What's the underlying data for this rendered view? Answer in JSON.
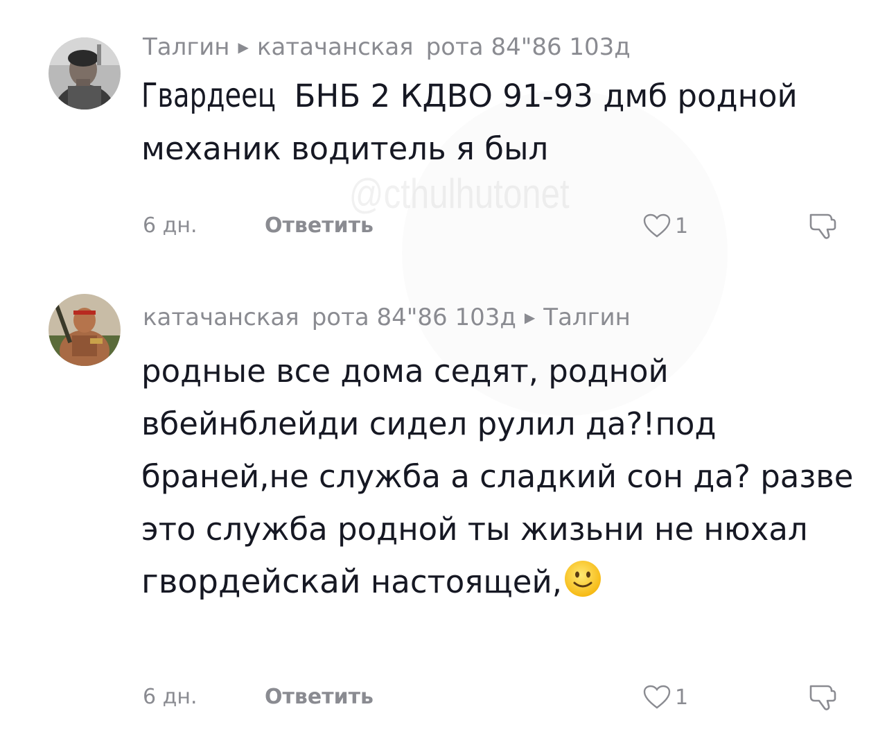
{
  "watermark": "@cthulhutonet",
  "comments": [
    {
      "author": "Талгин",
      "reply_to_name": "катачанская",
      "reply_to_rank": "рота 84\"86 103д",
      "text_condensed": "Гвардеец",
      "text_rest": " БНБ 2 КДВО 91-93 дмб родной механик водитель я был",
      "time": "6 дн.",
      "reply_label": "Ответить",
      "like_count": "1",
      "like_icon": "heart-outline-icon",
      "dislike_icon": "thumb-down-icon"
    },
    {
      "author_name": "катачанская",
      "author_rank": "рота 84\"86 103д",
      "reply_to": "Талгин",
      "text_main": "родные все дома седят, родной вбейнблейди сидел рулил да?!под браней,не служба а сладкий сон да? разве это служба родной ты жизьни не нюхал ",
      "text_emph": "гвордейскай",
      "text_end": " настоящей,",
      "emoji": "slightly-smiling-face",
      "time": "6 дн.",
      "reply_label": "Ответить",
      "like_count": "1",
      "like_icon": "heart-outline-icon",
      "dislike_icon": "thumb-down-icon"
    }
  ]
}
